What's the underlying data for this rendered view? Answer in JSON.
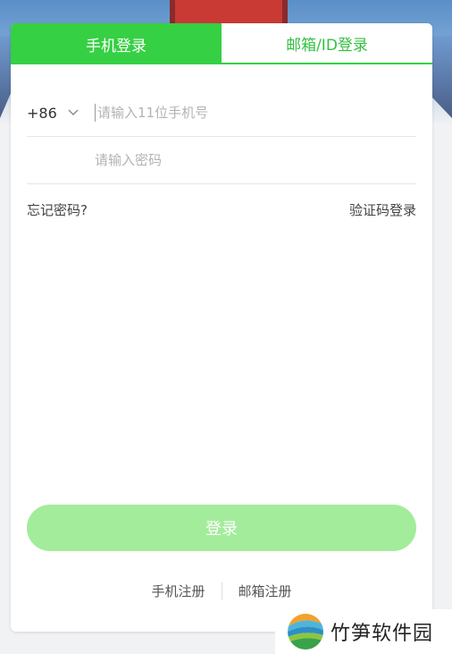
{
  "tabs": {
    "phone_login": "手机登录",
    "email_login": "邮箱/ID登录"
  },
  "form": {
    "country_code": "+86",
    "phone_placeholder": "请输入11位手机号",
    "password_placeholder": "请输入密码"
  },
  "links": {
    "forgot_password": "忘记密码?",
    "sms_login": "验证码登录"
  },
  "login_button": "登录",
  "register": {
    "phone": "手机注册",
    "email": "邮箱注册"
  },
  "watermark": {
    "text": "竹笋软件园"
  },
  "colors": {
    "accent": "#35d043",
    "button_disabled": "#a3ec9b"
  }
}
